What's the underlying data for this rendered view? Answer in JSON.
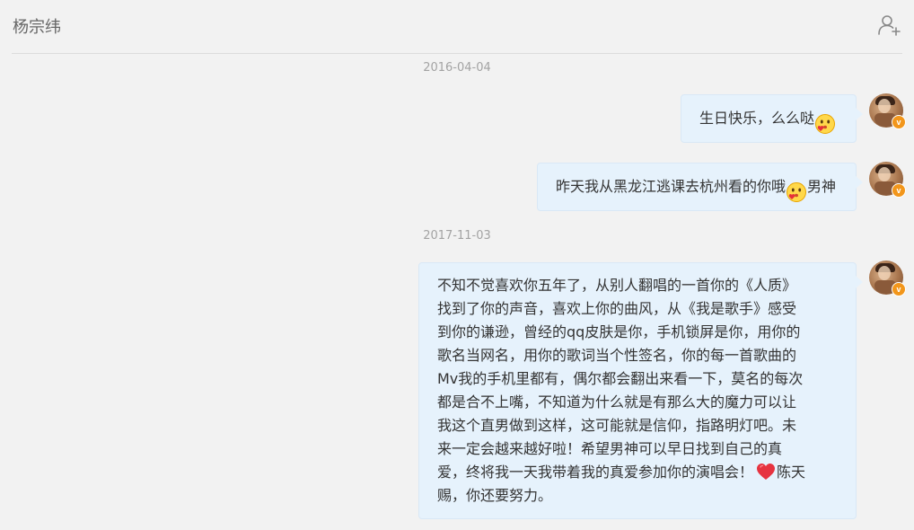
{
  "header": {
    "contact_name": "杨宗纬",
    "add_contact_icon": "add-user-icon"
  },
  "conversation": {
    "groups": [
      {
        "timestamp": "2016-04-04",
        "messages": [
          {
            "text_before": "生日快乐，么么哒",
            "emoji": "kiss-face-emoji",
            "text_after": ""
          },
          {
            "text_before": "昨天我从黑龙江逃课去杭州看的你哦",
            "emoji": "kiss-face-emoji",
            "text_after": "男神"
          }
        ]
      },
      {
        "timestamp": "2017-11-03",
        "messages": [
          {
            "text_before": "不知不觉喜欢你五年了，从别人翻唱的一首你的《人质》\n找到了你的声音，喜欢上你的曲风，从《我是歌手》感受\n到你的谦逊，曾经的qq皮肤是你，手机锁屏是你，用你的\n歌名当网名，用你的歌词当个性签名，你的每一首歌曲的\nMv我的手机里都有，偶尔都会翻出来看一下，莫名的每次\n都是合不上嘴，不知道为什么就是有那么大的魔力可以让\n我这个直男做到这样，这可能就是信仰，指路明灯吧。未\n来一定会越来越好啦！希望男神可以早日找到自己的真\n爱，终将我一天我带着我的真爱参加你的演唱会！",
            "emoji": "red-heart-emoji",
            "text_after": "陈天\n赐，你还要努力。"
          }
        ]
      }
    ]
  },
  "sender": {
    "avatar_icon": "user-avatar",
    "badge_text": "v",
    "badge_color": "#f2961b"
  },
  "colors": {
    "bubble_bg": "#e6f2fc",
    "background": "#f2f2f2",
    "timestamp": "#a3a3a3"
  }
}
